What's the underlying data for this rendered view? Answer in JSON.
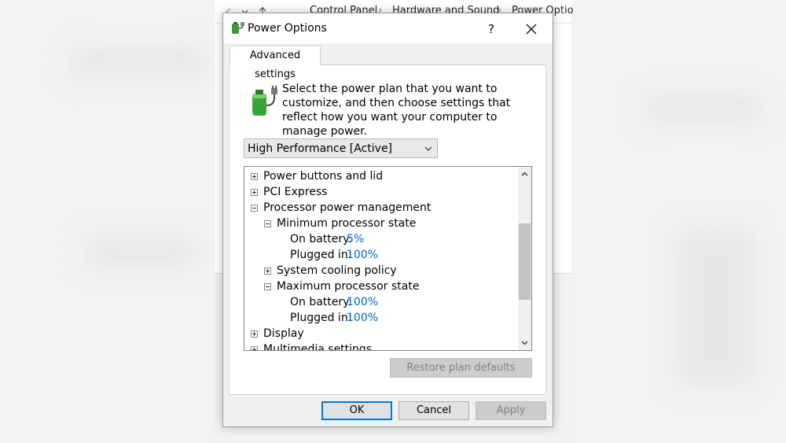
{
  "explorer": {
    "breadcrumb": [
      "Control Panel",
      "Hardware and Sound",
      "Power Optio"
    ]
  },
  "dialog": {
    "title": "Power Options",
    "help_label": "?",
    "tab_label": "Advanced settings",
    "description": "Select the power plan that you want to customize, and then choose settings that reflect how you want your computer to manage power.",
    "plan_select": {
      "value": "High Performance [Active]"
    },
    "tree": [
      {
        "label": "Power buttons and lid",
        "level": 0,
        "toggle": "plus"
      },
      {
        "label": "PCI Express",
        "level": 0,
        "toggle": "plus"
      },
      {
        "label": "Processor power management",
        "level": 0,
        "toggle": "minus"
      },
      {
        "label": "Minimum processor state",
        "level": 1,
        "toggle": "minus"
      },
      {
        "label": "On battery:",
        "level": 2,
        "value": "5%"
      },
      {
        "label": "Plugged in:",
        "level": 2,
        "value": "100%"
      },
      {
        "label": "System cooling policy",
        "level": 1,
        "toggle": "plus"
      },
      {
        "label": "Maximum processor state",
        "level": 1,
        "toggle": "minus"
      },
      {
        "label": "On battery:",
        "level": 2,
        "value": "100%"
      },
      {
        "label": "Plugged in:",
        "level": 2,
        "value": "100%"
      },
      {
        "label": "Display",
        "level": 0,
        "toggle": "plus"
      },
      {
        "label": "Multimedia settings",
        "level": 0,
        "toggle": "plus"
      }
    ],
    "restore_label": "Restore plan defaults",
    "buttons": {
      "ok": "OK",
      "cancel": "Cancel",
      "apply": "Apply"
    }
  },
  "colors": {
    "link_value": "#0066cc",
    "focus_border": "#0078d7",
    "disabled_text": "#838383"
  },
  "icons": [
    "power-options-icon",
    "close-icon",
    "battery-plug-icon",
    "chevron-down-icon",
    "scroll-up-icon",
    "scroll-down-icon",
    "back-arrow-icon",
    "up-arrow-icon"
  ]
}
